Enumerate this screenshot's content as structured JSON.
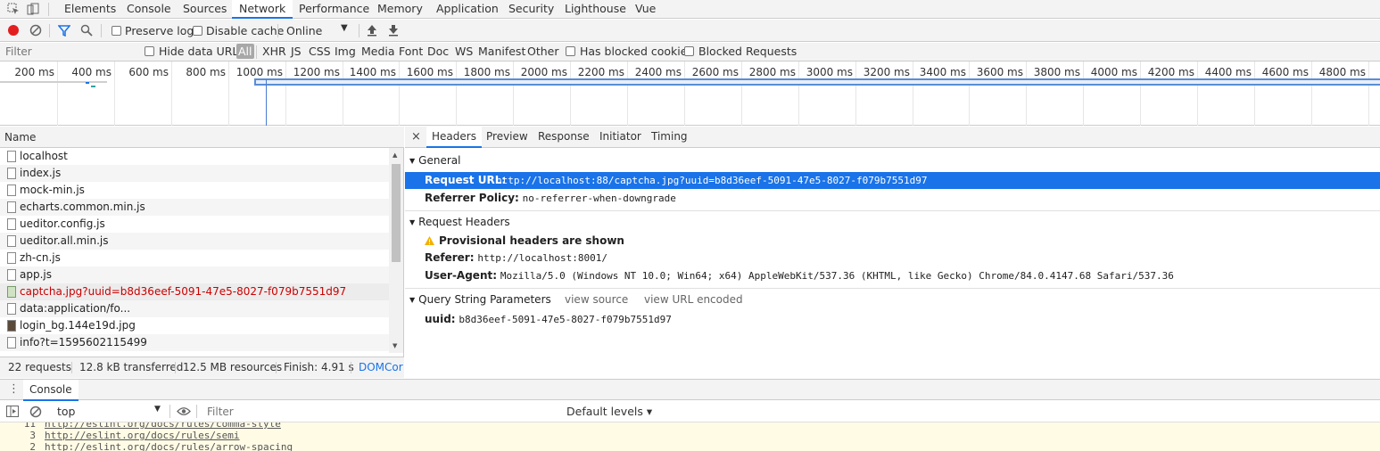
{
  "top_tabs": [
    "Elements",
    "Console",
    "Sources",
    "Network",
    "Performance",
    "Memory",
    "Application",
    "Security",
    "Lighthouse",
    "Vue"
  ],
  "active_top_tab": "Network",
  "toolbar": {
    "preserve_log": "Preserve log",
    "disable_cache": "Disable cache",
    "throttling": "Online"
  },
  "filter": {
    "placeholder": "Filter",
    "hide_data_urls": "Hide data URLs",
    "types": [
      "All",
      "XHR",
      "JS",
      "CSS",
      "Img",
      "Media",
      "Font",
      "Doc",
      "WS",
      "Manifest",
      "Other"
    ],
    "has_blocked_cookies": "Has blocked cookies",
    "blocked_requests": "Blocked Requests"
  },
  "timeline": {
    "ticks": [
      "200 ms",
      "400 ms",
      "600 ms",
      "800 ms",
      "1000 ms",
      "1200 ms",
      "1400 ms",
      "1600 ms",
      "1800 ms",
      "2000 ms",
      "2200 ms",
      "2400 ms",
      "2600 ms",
      "2800 ms",
      "3000 ms",
      "3200 ms",
      "3400 ms",
      "3600 ms",
      "3800 ms",
      "4000 ms",
      "4200 ms",
      "4400 ms",
      "4600 ms",
      "4800 ms"
    ]
  },
  "requests": {
    "header": "Name",
    "items": [
      {
        "name": "localhost"
      },
      {
        "name": "index.js"
      },
      {
        "name": "mock-min.js"
      },
      {
        "name": "echarts.common.min.js"
      },
      {
        "name": "ueditor.config.js"
      },
      {
        "name": "ueditor.all.min.js"
      },
      {
        "name": "zh-cn.js"
      },
      {
        "name": "app.js"
      },
      {
        "name": "captcha.jpg?uuid=b8d36eef-5091-47e5-8027-f079b7551d97"
      },
      {
        "name": "data:application/fo..."
      },
      {
        "name": "login_bg.144e19d.jpg"
      },
      {
        "name": "info?t=1595602115499"
      }
    ],
    "selected_index": 8
  },
  "summary": {
    "requests": "22 requests",
    "transferred": "12.8 kB transferred",
    "resources": "12.5 MB resources",
    "finish": "Finish: 4.91 s",
    "domcontent": "DOMCor"
  },
  "detail": {
    "close": "×",
    "tabs": [
      "Headers",
      "Preview",
      "Response",
      "Initiator",
      "Timing"
    ],
    "active_tab": "Headers",
    "general": {
      "title": "General",
      "request_url_key": "Request URL:",
      "request_url": "http://localhost:88/captcha.jpg?uuid=b8d36eef-5091-47e5-8027-f079b7551d97",
      "referrer_policy_key": "Referrer Policy:",
      "referrer_policy": "no-referrer-when-downgrade"
    },
    "request_headers": {
      "title": "Request Headers",
      "warning": "Provisional headers are shown",
      "referer_key": "Referer:",
      "referer": "http://localhost:8001/",
      "user_agent_key": "User-Agent:",
      "user_agent": "Mozilla/5.0 (Windows NT 10.0; Win64; x64) AppleWebKit/537.36 (KHTML, like Gecko) Chrome/84.0.4147.68 Safari/537.36"
    },
    "query": {
      "title": "Query String Parameters",
      "view_source": "view source",
      "view_url_encoded": "view URL encoded",
      "uuid_key": "uuid:",
      "uuid": "b8d36eef-5091-47e5-8027-f079b7551d97"
    }
  },
  "drawer": {
    "tab": "Console",
    "context": "top",
    "filter_placeholder": "Filter",
    "levels": "Default levels ▾",
    "lines": [
      {
        "n": "11",
        "url": "http://eslint.org/docs/rules/comma-style"
      },
      {
        "n": "3",
        "url": "http://eslint.org/docs/rules/semi"
      },
      {
        "n": "2",
        "url": "http://eslint.org/docs/rules/arrow-spacing"
      }
    ]
  },
  "colors": {
    "accent": "#1a73e8",
    "record": "#e21e1e",
    "selected_row_text": "#cc0000",
    "highlight": "#1a73e8",
    "console_bg": "#fffbe5"
  }
}
